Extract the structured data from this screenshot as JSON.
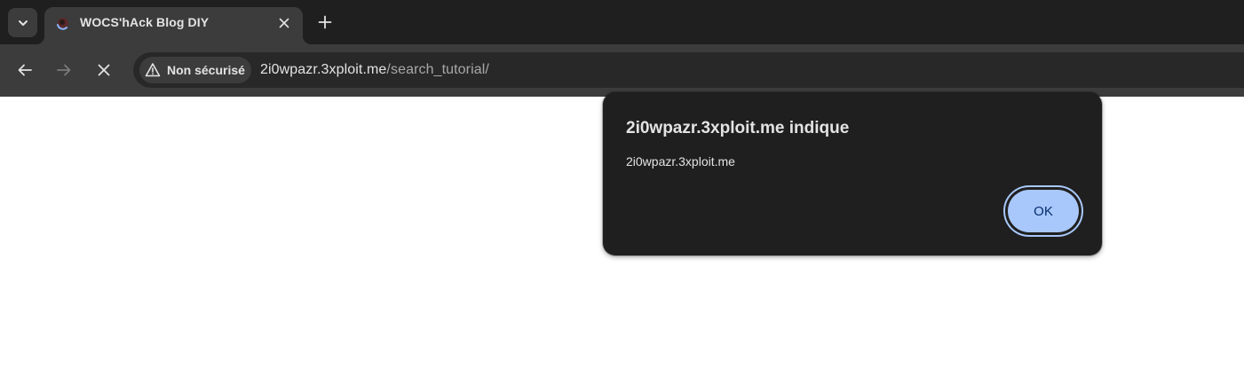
{
  "browser": {
    "tab": {
      "title": "WOCS'hAck Blog DIY",
      "favicon": "loading-spinner-icon"
    },
    "omnibox": {
      "security_label": "Non sécurisé",
      "url_host": "2i0wpazr.3xploit.me",
      "url_path": "/search_tutorial/"
    }
  },
  "dialog": {
    "title": "2i0wpazr.3xploit.me indique",
    "message": "2i0wpazr.3xploit.me",
    "ok_label": "OK"
  },
  "colors": {
    "tabstrip_bg": "#1f1f1f",
    "toolbar_bg": "#3c3c3c",
    "omnibox_bg": "#282828",
    "dialog_bg": "#1f1f1f",
    "ok_button_bg": "#a8c7fa",
    "ok_button_text": "#062e6f"
  }
}
